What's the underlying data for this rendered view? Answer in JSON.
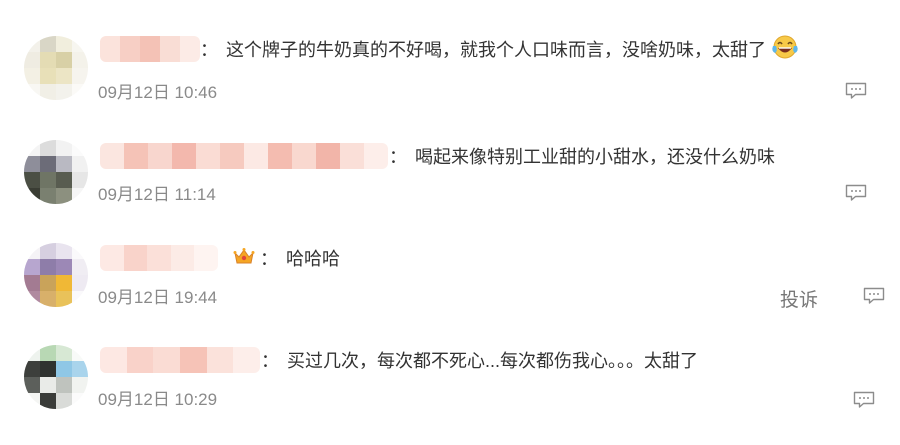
{
  "comments": [
    {
      "text": "这个牌子的牛奶真的不好喝，就我个人口味而言，没啥奶味，太甜了",
      "separator": "：",
      "time": "09月12日 10:46",
      "emoji_icon": "laughing-tears-emoji-icon",
      "reply_icon": "comment-bubble-icon"
    },
    {
      "text": "喝起来像特别工业甜的小甜水，还没什么奶味",
      "separator": "：",
      "time": "09月12日 11:14",
      "reply_icon": "comment-bubble-icon"
    },
    {
      "text": "哈哈哈",
      "separator": "：",
      "time": "09月12日 19:44",
      "badge_icon": "crown-badge-icon",
      "report": "投诉",
      "reply_icon": "comment-bubble-icon"
    },
    {
      "text": "买过几次，每次都不死心...每次都伤我心。。。太甜了",
      "separator": "：",
      "time": "09月12日 10:29",
      "reply_icon": "comment-bubble-icon"
    }
  ],
  "colors": {
    "text": "#333333",
    "meta": "#8a8a8a",
    "icon": "#8c8c8c",
    "name_blur": "#f3b8ad"
  }
}
